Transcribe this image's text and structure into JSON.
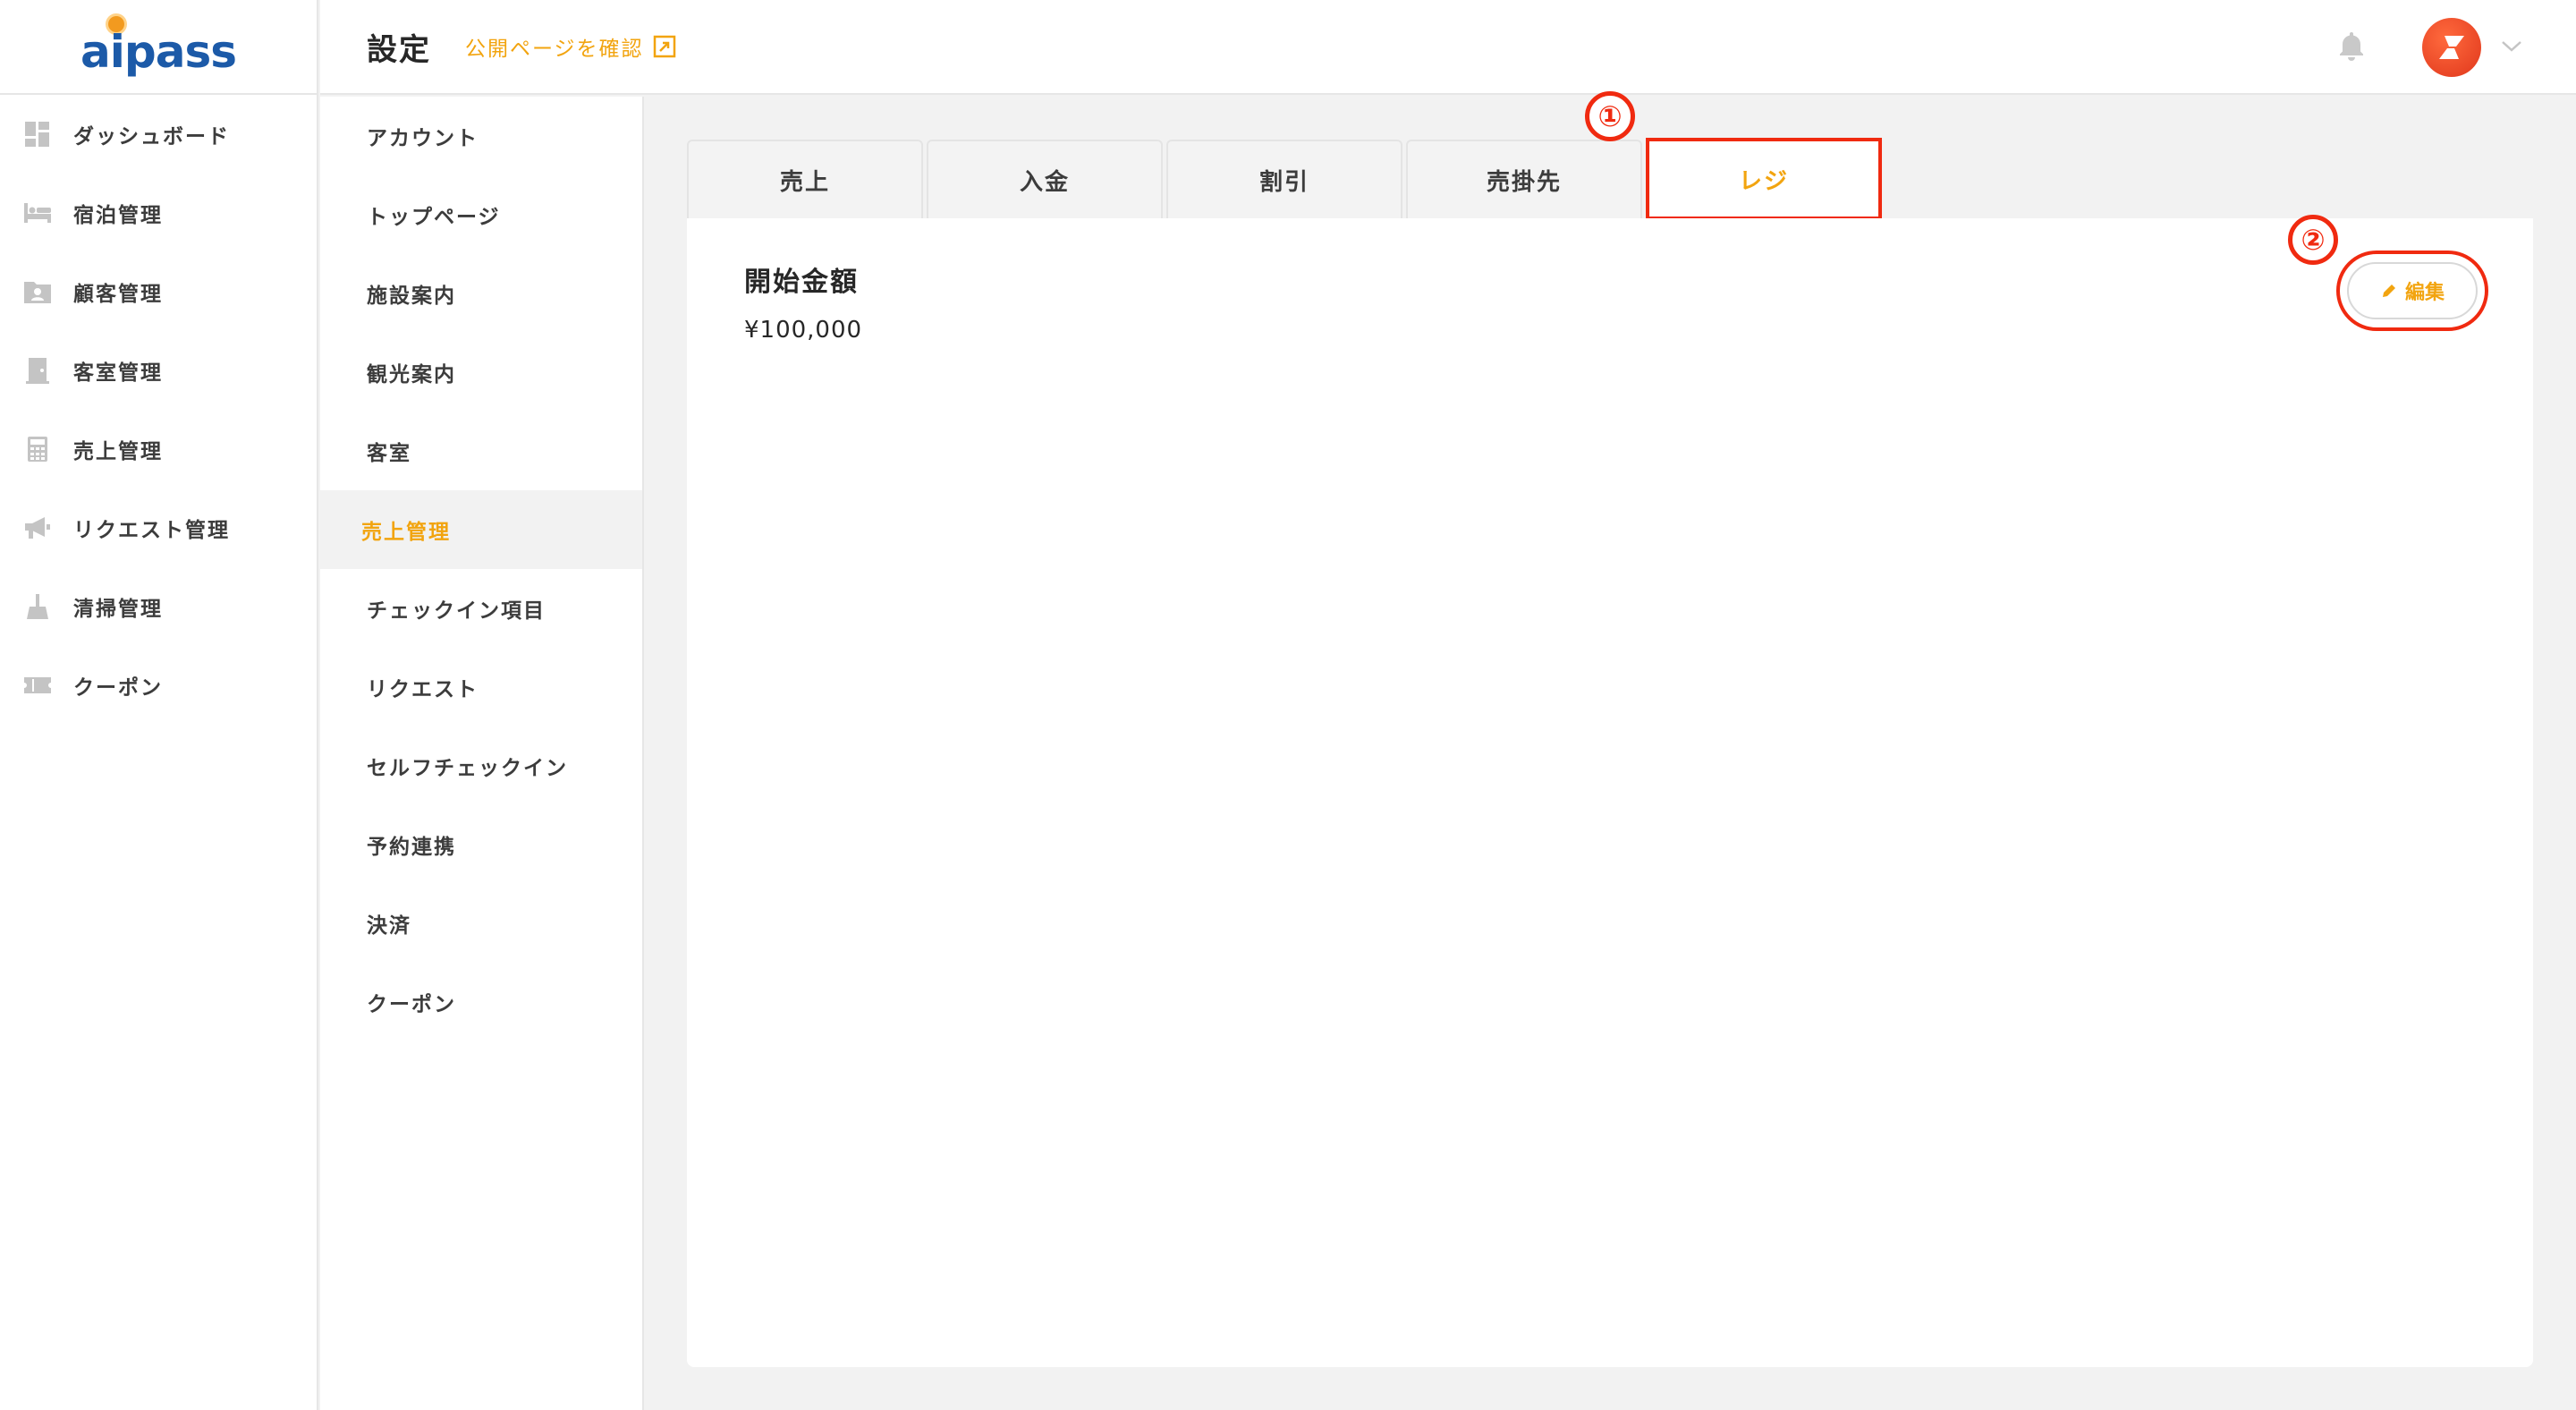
{
  "brand": {
    "name": "aipass"
  },
  "sidebar": {
    "items": [
      {
        "label": "ダッシュボード",
        "icon": "dashboard-icon"
      },
      {
        "label": "宿泊管理",
        "icon": "bed-icon"
      },
      {
        "label": "顧客管理",
        "icon": "customer-folder-icon"
      },
      {
        "label": "客室管理",
        "icon": "door-icon"
      },
      {
        "label": "売上管理",
        "icon": "calculator-icon"
      },
      {
        "label": "リクエスト管理",
        "icon": "megaphone-icon"
      },
      {
        "label": "清掃管理",
        "icon": "broom-icon"
      },
      {
        "label": "クーポン",
        "icon": "ticket-icon"
      }
    ]
  },
  "header": {
    "title": "設定",
    "public_link": "公開ページを確認"
  },
  "submenu": {
    "items": [
      {
        "label": "アカウント"
      },
      {
        "label": "トップページ"
      },
      {
        "label": "施設案内"
      },
      {
        "label": "観光案内"
      },
      {
        "label": "客室"
      },
      {
        "label": "売上管理",
        "active": true
      },
      {
        "label": "チェックイン項目"
      },
      {
        "label": "リクエスト"
      },
      {
        "label": "セルフチェックイン"
      },
      {
        "label": "予約連携"
      },
      {
        "label": "決済"
      },
      {
        "label": "クーポン"
      }
    ]
  },
  "tabs": [
    {
      "label": "売上"
    },
    {
      "label": "入金"
    },
    {
      "label": "割引"
    },
    {
      "label": "売掛先"
    },
    {
      "label": "レジ",
      "active": true
    }
  ],
  "panel": {
    "field_label": "開始金額",
    "field_value": "¥100,000",
    "edit_label": "編集"
  },
  "annotations": {
    "step1": "①",
    "step2": "②"
  },
  "colors": {
    "accent": "#f2a40f",
    "highlight": "#f02a10",
    "brand": "#1c5aa8"
  }
}
